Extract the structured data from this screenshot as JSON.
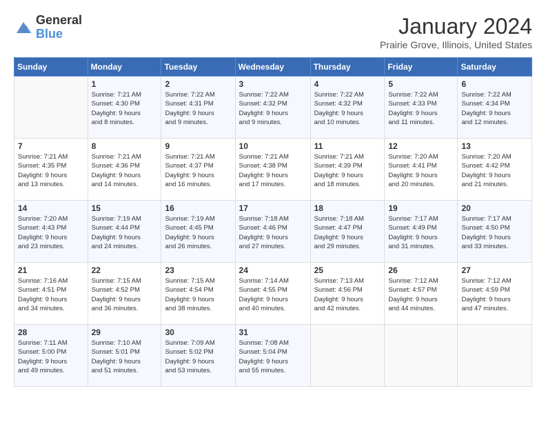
{
  "header": {
    "logo_general": "General",
    "logo_blue": "Blue",
    "month_title": "January 2024",
    "location": "Prairie Grove, Illinois, United States"
  },
  "days_of_week": [
    "Sunday",
    "Monday",
    "Tuesday",
    "Wednesday",
    "Thursday",
    "Friday",
    "Saturday"
  ],
  "weeks": [
    [
      {
        "day": "",
        "info": ""
      },
      {
        "day": "1",
        "info": "Sunrise: 7:21 AM\nSunset: 4:30 PM\nDaylight: 9 hours\nand 8 minutes."
      },
      {
        "day": "2",
        "info": "Sunrise: 7:22 AM\nSunset: 4:31 PM\nDaylight: 9 hours\nand 9 minutes."
      },
      {
        "day": "3",
        "info": "Sunrise: 7:22 AM\nSunset: 4:32 PM\nDaylight: 9 hours\nand 9 minutes."
      },
      {
        "day": "4",
        "info": "Sunrise: 7:22 AM\nSunset: 4:32 PM\nDaylight: 9 hours\nand 10 minutes."
      },
      {
        "day": "5",
        "info": "Sunrise: 7:22 AM\nSunset: 4:33 PM\nDaylight: 9 hours\nand 11 minutes."
      },
      {
        "day": "6",
        "info": "Sunrise: 7:22 AM\nSunset: 4:34 PM\nDaylight: 9 hours\nand 12 minutes."
      }
    ],
    [
      {
        "day": "7",
        "info": "Sunrise: 7:21 AM\nSunset: 4:35 PM\nDaylight: 9 hours\nand 13 minutes."
      },
      {
        "day": "8",
        "info": "Sunrise: 7:21 AM\nSunset: 4:36 PM\nDaylight: 9 hours\nand 14 minutes."
      },
      {
        "day": "9",
        "info": "Sunrise: 7:21 AM\nSunset: 4:37 PM\nDaylight: 9 hours\nand 16 minutes."
      },
      {
        "day": "10",
        "info": "Sunrise: 7:21 AM\nSunset: 4:38 PM\nDaylight: 9 hours\nand 17 minutes."
      },
      {
        "day": "11",
        "info": "Sunrise: 7:21 AM\nSunset: 4:39 PM\nDaylight: 9 hours\nand 18 minutes."
      },
      {
        "day": "12",
        "info": "Sunrise: 7:20 AM\nSunset: 4:41 PM\nDaylight: 9 hours\nand 20 minutes."
      },
      {
        "day": "13",
        "info": "Sunrise: 7:20 AM\nSunset: 4:42 PM\nDaylight: 9 hours\nand 21 minutes."
      }
    ],
    [
      {
        "day": "14",
        "info": "Sunrise: 7:20 AM\nSunset: 4:43 PM\nDaylight: 9 hours\nand 23 minutes."
      },
      {
        "day": "15",
        "info": "Sunrise: 7:19 AM\nSunset: 4:44 PM\nDaylight: 9 hours\nand 24 minutes."
      },
      {
        "day": "16",
        "info": "Sunrise: 7:19 AM\nSunset: 4:45 PM\nDaylight: 9 hours\nand 26 minutes."
      },
      {
        "day": "17",
        "info": "Sunrise: 7:18 AM\nSunset: 4:46 PM\nDaylight: 9 hours\nand 27 minutes."
      },
      {
        "day": "18",
        "info": "Sunrise: 7:18 AM\nSunset: 4:47 PM\nDaylight: 9 hours\nand 29 minutes."
      },
      {
        "day": "19",
        "info": "Sunrise: 7:17 AM\nSunset: 4:49 PM\nDaylight: 9 hours\nand 31 minutes."
      },
      {
        "day": "20",
        "info": "Sunrise: 7:17 AM\nSunset: 4:50 PM\nDaylight: 9 hours\nand 33 minutes."
      }
    ],
    [
      {
        "day": "21",
        "info": "Sunrise: 7:16 AM\nSunset: 4:51 PM\nDaylight: 9 hours\nand 34 minutes."
      },
      {
        "day": "22",
        "info": "Sunrise: 7:15 AM\nSunset: 4:52 PM\nDaylight: 9 hours\nand 36 minutes."
      },
      {
        "day": "23",
        "info": "Sunrise: 7:15 AM\nSunset: 4:54 PM\nDaylight: 9 hours\nand 38 minutes."
      },
      {
        "day": "24",
        "info": "Sunrise: 7:14 AM\nSunset: 4:55 PM\nDaylight: 9 hours\nand 40 minutes."
      },
      {
        "day": "25",
        "info": "Sunrise: 7:13 AM\nSunset: 4:56 PM\nDaylight: 9 hours\nand 42 minutes."
      },
      {
        "day": "26",
        "info": "Sunrise: 7:12 AM\nSunset: 4:57 PM\nDaylight: 9 hours\nand 44 minutes."
      },
      {
        "day": "27",
        "info": "Sunrise: 7:12 AM\nSunset: 4:59 PM\nDaylight: 9 hours\nand 47 minutes."
      }
    ],
    [
      {
        "day": "28",
        "info": "Sunrise: 7:11 AM\nSunset: 5:00 PM\nDaylight: 9 hours\nand 49 minutes."
      },
      {
        "day": "29",
        "info": "Sunrise: 7:10 AM\nSunset: 5:01 PM\nDaylight: 9 hours\nand 51 minutes."
      },
      {
        "day": "30",
        "info": "Sunrise: 7:09 AM\nSunset: 5:02 PM\nDaylight: 9 hours\nand 53 minutes."
      },
      {
        "day": "31",
        "info": "Sunrise: 7:08 AM\nSunset: 5:04 PM\nDaylight: 9 hours\nand 55 minutes."
      },
      {
        "day": "",
        "info": ""
      },
      {
        "day": "",
        "info": ""
      },
      {
        "day": "",
        "info": ""
      }
    ]
  ]
}
